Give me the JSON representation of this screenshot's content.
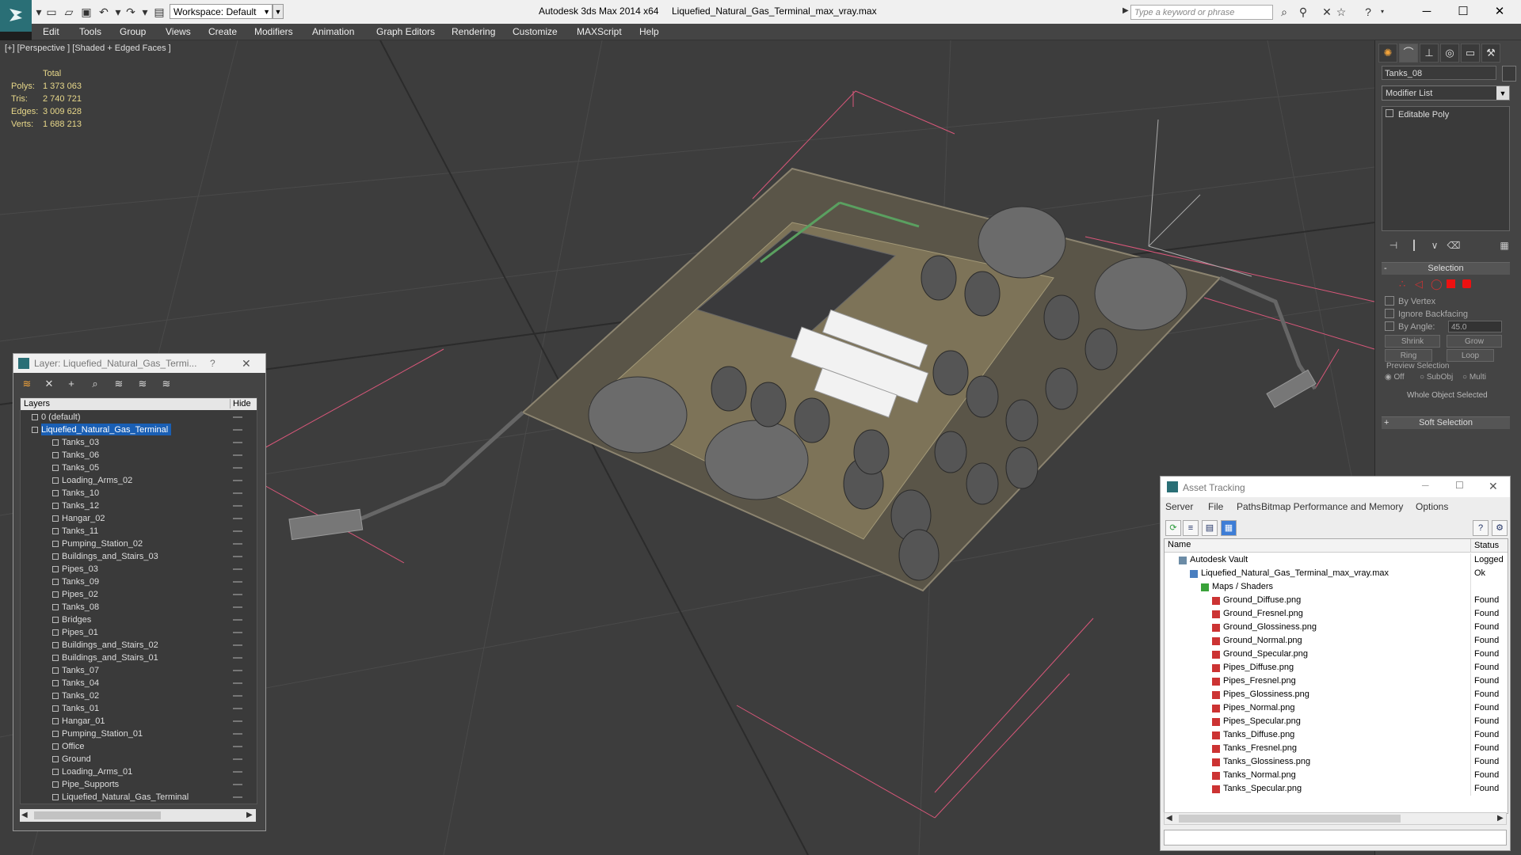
{
  "titlebar": {
    "workspace": "Workspace: Default",
    "app_title": "Autodesk 3ds Max  2014 x64",
    "file_title": "Liquefied_Natural_Gas_Terminal_max_vray.max",
    "search_placeholder": "Type a keyword or phrase"
  },
  "menu": [
    "Edit",
    "Tools",
    "Group",
    "Views",
    "Create",
    "Modifiers",
    "Animation",
    "Graph Editors",
    "Rendering",
    "Customize",
    "MAXScript",
    "Help"
  ],
  "viewport": {
    "label": "[+] [Perspective ] [Shaded + Edged Faces ]",
    "stats": {
      "header": "Total",
      "polys_label": "Polys:",
      "polys": "1 373 063",
      "tris_label": "Tris:",
      "tris": "2 740 721",
      "edges_label": "Edges:",
      "edges": "3 009 628",
      "verts_label": "Verts:",
      "verts": "1 688 213"
    }
  },
  "command_panel": {
    "object_name": "Tanks_08",
    "modifier_list": "Modifier List",
    "stack_item": "Editable Poly",
    "selection_title": "Selection",
    "by_vertex": "By Vertex",
    "ignore_backfacing": "Ignore Backfacing",
    "by_angle": "By Angle:",
    "angle_value": "45.0",
    "shrink": "Shrink",
    "grow": "Grow",
    "ring": "Ring",
    "loop": "Loop",
    "preview_selection": "Preview Selection",
    "off": "Off",
    "subobj": "SubObj",
    "multi": "Multi",
    "whole_object": "Whole Object Selected",
    "soft_selection": "Soft Selection"
  },
  "layer_explorer": {
    "title": "Layer: Liquefied_Natural_Gas_Termi...",
    "col_layers": "Layers",
    "col_hide": "Hide",
    "layers": [
      {
        "name": "0 (default)",
        "level": 0
      },
      {
        "name": "Liquefied_Natural_Gas_Terminal",
        "level": 0,
        "selected": true
      },
      {
        "name": "Tanks_03",
        "level": 1
      },
      {
        "name": "Tanks_06",
        "level": 1
      },
      {
        "name": "Tanks_05",
        "level": 1
      },
      {
        "name": "Loading_Arms_02",
        "level": 1
      },
      {
        "name": "Tanks_10",
        "level": 1
      },
      {
        "name": "Tanks_12",
        "level": 1
      },
      {
        "name": "Hangar_02",
        "level": 1
      },
      {
        "name": "Tanks_11",
        "level": 1
      },
      {
        "name": "Pumping_Station_02",
        "level": 1
      },
      {
        "name": "Buildings_and_Stairs_03",
        "level": 1
      },
      {
        "name": "Pipes_03",
        "level": 1
      },
      {
        "name": "Tanks_09",
        "level": 1
      },
      {
        "name": "Pipes_02",
        "level": 1
      },
      {
        "name": "Tanks_08",
        "level": 1
      },
      {
        "name": "Bridges",
        "level": 1
      },
      {
        "name": "Pipes_01",
        "level": 1
      },
      {
        "name": "Buildings_and_Stairs_02",
        "level": 1
      },
      {
        "name": "Buildings_and_Stairs_01",
        "level": 1
      },
      {
        "name": "Tanks_07",
        "level": 1
      },
      {
        "name": "Tanks_04",
        "level": 1
      },
      {
        "name": "Tanks_02",
        "level": 1
      },
      {
        "name": "Tanks_01",
        "level": 1
      },
      {
        "name": "Hangar_01",
        "level": 1
      },
      {
        "name": "Pumping_Station_01",
        "level": 1
      },
      {
        "name": "Office",
        "level": 1
      },
      {
        "name": "Ground",
        "level": 1
      },
      {
        "name": "Loading_Arms_01",
        "level": 1
      },
      {
        "name": "Pipe_Supports",
        "level": 1
      },
      {
        "name": "Liquefied_Natural_Gas_Terminal",
        "level": 1
      }
    ]
  },
  "asset_tracking": {
    "title": "Asset Tracking",
    "menu": [
      "Server",
      "File",
      "Paths",
      "Bitmap Performance and Memory",
      "Options"
    ],
    "col_name": "Name",
    "col_status": "Status",
    "rows": [
      {
        "name": "Autodesk Vault",
        "status": "Logged Out",
        "level": 0,
        "icon": "vault"
      },
      {
        "name": "Liquefied_Natural_Gas_Terminal_max_vray.max",
        "status": "Ok",
        "level": 1,
        "icon": "file"
      },
      {
        "name": "Maps / Shaders",
        "status": "",
        "level": 2,
        "icon": "maps"
      },
      {
        "name": "Ground_Diffuse.png",
        "status": "Found",
        "level": 3,
        "icon": "png"
      },
      {
        "name": "Ground_Fresnel.png",
        "status": "Found",
        "level": 3,
        "icon": "png"
      },
      {
        "name": "Ground_Glossiness.png",
        "status": "Found",
        "level": 3,
        "icon": "png"
      },
      {
        "name": "Ground_Normal.png",
        "status": "Found",
        "level": 3,
        "icon": "png"
      },
      {
        "name": "Ground_Specular.png",
        "status": "Found",
        "level": 3,
        "icon": "png"
      },
      {
        "name": "Pipes_Diffuse.png",
        "status": "Found",
        "level": 3,
        "icon": "png"
      },
      {
        "name": "Pipes_Fresnel.png",
        "status": "Found",
        "level": 3,
        "icon": "png"
      },
      {
        "name": "Pipes_Glossiness.png",
        "status": "Found",
        "level": 3,
        "icon": "png"
      },
      {
        "name": "Pipes_Normal.png",
        "status": "Found",
        "level": 3,
        "icon": "png"
      },
      {
        "name": "Pipes_Specular.png",
        "status": "Found",
        "level": 3,
        "icon": "png"
      },
      {
        "name": "Tanks_Diffuse.png",
        "status": "Found",
        "level": 3,
        "icon": "png"
      },
      {
        "name": "Tanks_Fresnel.png",
        "status": "Found",
        "level": 3,
        "icon": "png"
      },
      {
        "name": "Tanks_Glossiness.png",
        "status": "Found",
        "level": 3,
        "icon": "png"
      },
      {
        "name": "Tanks_Normal.png",
        "status": "Found",
        "level": 3,
        "icon": "png"
      },
      {
        "name": "Tanks_Specular.png",
        "status": "Found",
        "level": 3,
        "icon": "png"
      }
    ]
  }
}
